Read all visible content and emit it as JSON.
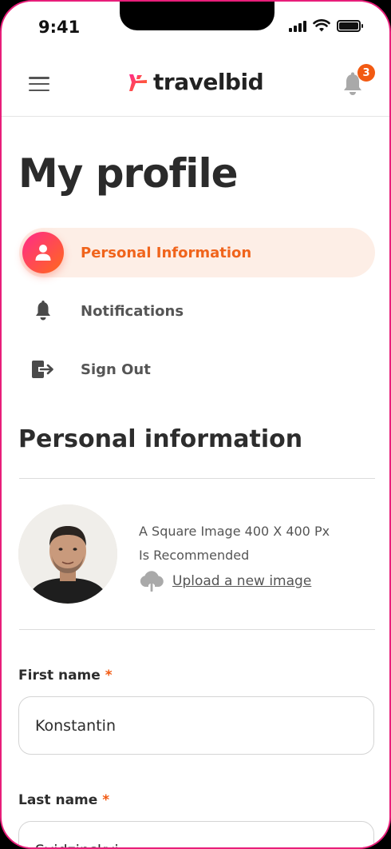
{
  "status_bar": {
    "time": "9:41"
  },
  "header": {
    "brand": "travelbid",
    "notification_count": "3",
    "brand_colors": {
      "gradient_start": "#ff2a8a",
      "gradient_end": "#ff6a1a",
      "badge": "#f25a12"
    }
  },
  "page": {
    "title": "My profile"
  },
  "nav": {
    "items": [
      {
        "label": "Personal Information",
        "icon": "user-icon",
        "active": true
      },
      {
        "label": "Notifications",
        "icon": "bell-icon",
        "active": false
      },
      {
        "label": "Sign Out",
        "icon": "sign-out-icon",
        "active": false
      }
    ]
  },
  "section": {
    "title": "Personal information",
    "upload_hint_line1": "A Square Image 400 X 400 Px",
    "upload_hint_line2": "Is Recommended",
    "upload_link": "Upload a new image"
  },
  "form": {
    "first_name_label": "First name",
    "first_name_value": "Konstantin",
    "last_name_label": "Last name",
    "last_name_value": "Svidzinskyi",
    "required_mark": "*"
  }
}
